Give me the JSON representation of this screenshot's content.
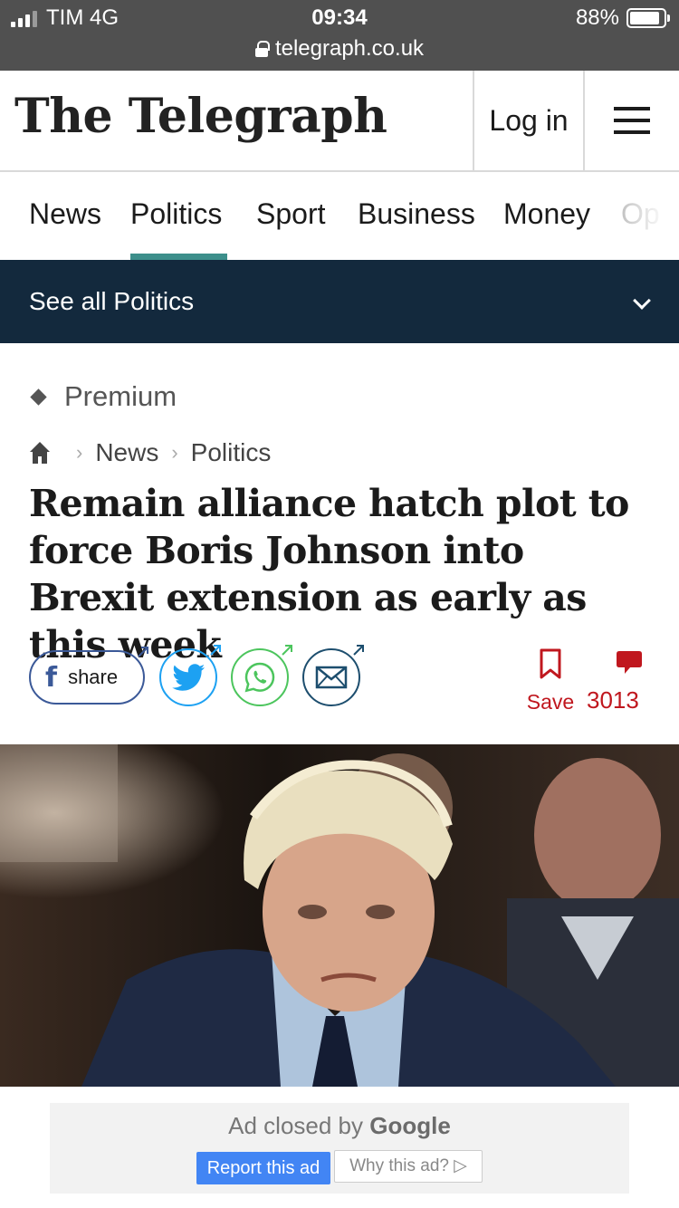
{
  "status_bar": {
    "carrier": "TIM 4G",
    "time": "09:34",
    "battery": "88%",
    "battery_level": 0.88,
    "url": "telegraph.co.uk"
  },
  "masthead": {
    "logo": "The Telegraph",
    "login_label": "Log in",
    "menu_icon": "hamburger-icon"
  },
  "section_nav": {
    "tabs": [
      {
        "label": "News",
        "active": false
      },
      {
        "label": "Politics",
        "active": true
      },
      {
        "label": "Sport",
        "active": false
      },
      {
        "label": "Business",
        "active": false
      },
      {
        "label": "Money",
        "active": false
      },
      {
        "label": "Op",
        "active": false
      }
    ],
    "accent_color": "#3d8f8b"
  },
  "see_all": {
    "label": "See all Politics",
    "icon": "chevron-down-icon",
    "background": "#13293d"
  },
  "article": {
    "premium_label": "Premium",
    "breadcrumb": [
      "News",
      "Politics"
    ],
    "headline": "Remain alliance hatch plot to force Boris Johnson into Brexit extension as early as this week",
    "share": {
      "facebook_label": "share",
      "icons": [
        "facebook-icon",
        "twitter-icon",
        "whatsapp-icon",
        "email-icon"
      ]
    },
    "save_label": "Save",
    "comments_count": "3013",
    "accent_red": "#c0171e"
  },
  "ad": {
    "closed_text": "Ad closed by",
    "brand": "Google",
    "report_label": "Report this ad",
    "why_label": "Why this ad?"
  }
}
